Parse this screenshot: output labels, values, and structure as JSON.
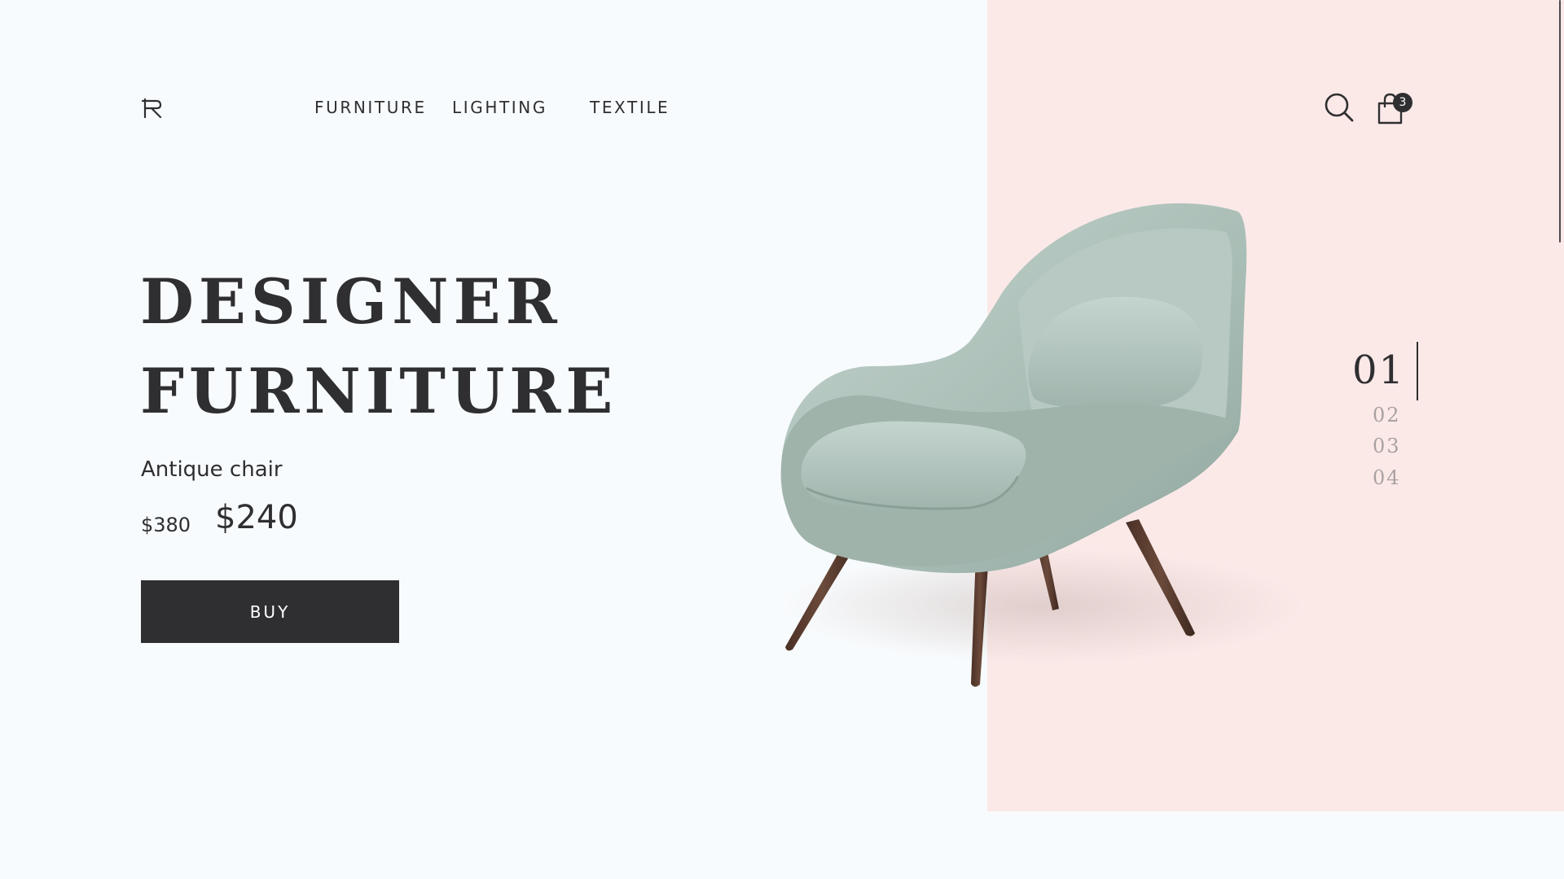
{
  "nav": {
    "items": [
      "FURNITURE",
      "LIGHTING",
      "TEXTILE"
    ]
  },
  "header": {
    "logo_icon": "chair-logo-icon",
    "search_icon": "search-icon",
    "cart_icon": "shopping-bag-icon",
    "cart_count": "3"
  },
  "hero": {
    "title_line1": "DESIGNER",
    "title_line2": "FURNITURE",
    "product_name": "Antique chair",
    "old_price": "$380",
    "new_price": "$240",
    "buy_label": "BUY"
  },
  "slider": {
    "current": "01",
    "others": [
      "02",
      "03",
      "04"
    ]
  },
  "colors": {
    "background": "#f8fbfd",
    "accent_panel": "#fbe9e8",
    "dark": "#2f2f31",
    "chair_fabric": "#a9beb6",
    "chair_legs": "#5a3d30",
    "muted_text": "#a9a2a2"
  }
}
